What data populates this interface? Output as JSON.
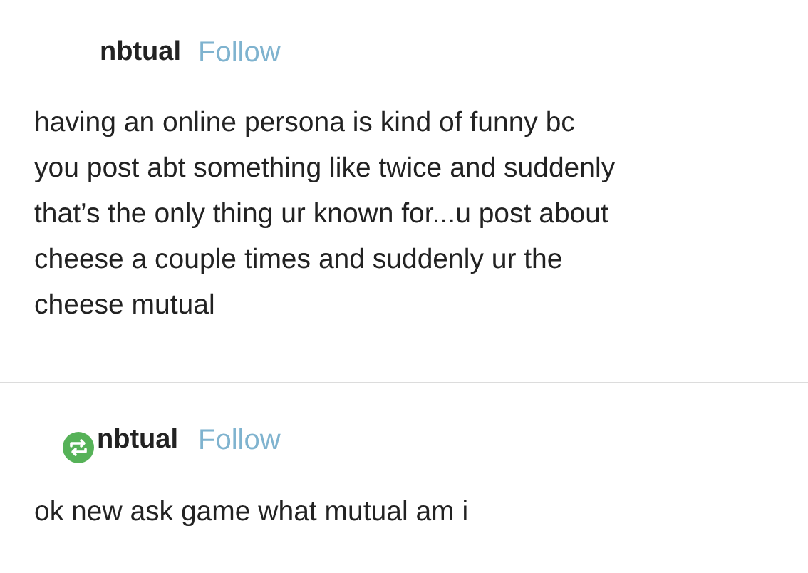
{
  "posts": [
    {
      "username": "nbtual",
      "follow": "Follow",
      "reblogged": false,
      "lines": [
        "having an online persona is kind of funny bc",
        "you post abt something like twice and suddenly",
        "that’s the only thing ur known for...u post about",
        "cheese a couple times and suddenly ur the",
        "cheese mutual"
      ]
    },
    {
      "username": "nbtual",
      "follow": "Follow",
      "reblogged": true,
      "lines": [
        "ok new ask game what mutual am i"
      ]
    }
  ]
}
